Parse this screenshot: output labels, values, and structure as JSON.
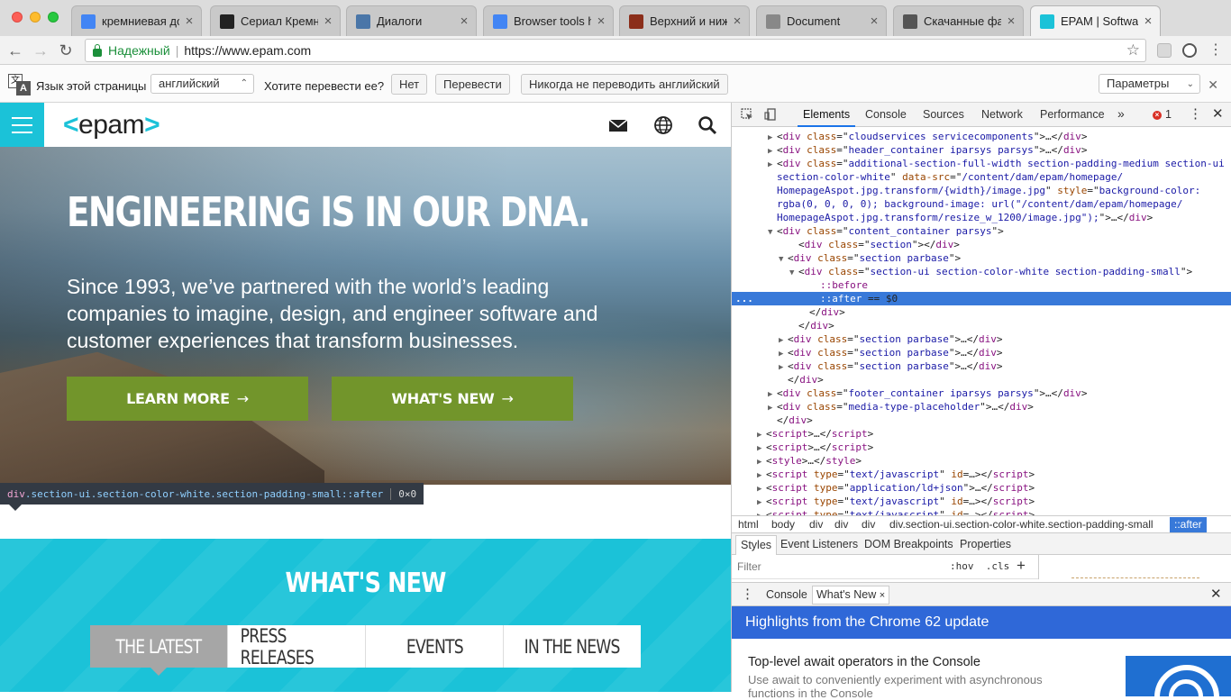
{
  "browser": {
    "tabs": [
      {
        "title": "кремниевая доли",
        "favicon": "google-icon",
        "color": "#4285f4"
      },
      {
        "title": "Сериал Кремние",
        "favicon": "play-icon",
        "color": "#222222"
      },
      {
        "title": "Диалоги",
        "favicon": "vk-icon",
        "color": "#4a76a8"
      },
      {
        "title": "Browser tools hon",
        "favicon": "docs-icon",
        "color": "#4285f4"
      },
      {
        "title": "Верхний и нижні",
        "favicon": "site-icon",
        "color": "#8b2e1a"
      },
      {
        "title": "Document",
        "favicon": "document-icon",
        "color": "#888888"
      },
      {
        "title": "Скачанные файл",
        "favicon": "download-icon",
        "color": "#555555"
      },
      {
        "title": "EPAM | Software",
        "favicon": "epam-icon",
        "color": "#1bc2d8",
        "active": true
      }
    ],
    "address": {
      "secure_label": "Надежный",
      "separator": "|",
      "url": "https://www.epam.com"
    }
  },
  "translate_bar": {
    "language_label": "Язык этой страницы",
    "language_value": "английский",
    "question": "Хотите перевести ее?",
    "no": "Нет",
    "translate": "Перевести",
    "never": "Никогда не переводить английский",
    "options": "Параметры"
  },
  "site": {
    "logo_left": "<",
    "logo_text": "epam",
    "logo_right": ">",
    "hero_title": "ENGINEERING IS IN OUR DNA.",
    "hero_subtitle": "Since 1993, we’ve partnered with the world’s leading companies to imagine, design, and engineer software and customer experiences that transform businesses.",
    "cta_primary": "LEARN MORE",
    "cta_secondary": "WHAT'S NEW",
    "arrow": "→",
    "whats_new_title": "WHAT'S NEW",
    "whats_new_tabs": [
      "THE LATEST",
      "PRESS RELEASES",
      "EVENTS",
      "IN THE NEWS"
    ],
    "inspect_tooltip": {
      "tag": "div",
      "classes": ".section-ui.section-color-white.section-padding-small::after",
      "size": "0×0"
    }
  },
  "devtools": {
    "tabs": [
      "Elements",
      "Console",
      "Sources",
      "Network",
      "Performance",
      "»"
    ],
    "error_count": "1",
    "dom_lines": [
      {
        "indent": 3,
        "tri": "▶",
        "parts": [
          [
            "p",
            "<"
          ],
          [
            "t",
            "div"
          ],
          [
            "p",
            " "
          ],
          [
            "an",
            "class"
          ],
          [
            "p",
            "=\""
          ],
          [
            "av",
            "cloudservices servicecomponents"
          ],
          [
            "p",
            "\">…</"
          ],
          [
            "t",
            "div"
          ],
          [
            "p",
            ">"
          ]
        ]
      },
      {
        "indent": 3,
        "tri": "▶",
        "parts": [
          [
            "p",
            "<"
          ],
          [
            "t",
            "div"
          ],
          [
            "p",
            " "
          ],
          [
            "an",
            "class"
          ],
          [
            "p",
            "=\""
          ],
          [
            "av",
            "header_container iparsys parsys"
          ],
          [
            "p",
            "\">…</"
          ],
          [
            "t",
            "div"
          ],
          [
            "p",
            ">"
          ]
        ]
      },
      {
        "indent": 3,
        "tri": "▶",
        "parts": [
          [
            "p",
            "<"
          ],
          [
            "t",
            "div"
          ],
          [
            "p",
            " "
          ],
          [
            "an",
            "class"
          ],
          [
            "p",
            "=\""
          ],
          [
            "av",
            "additional-section-full-width section-padding-medium section-ui"
          ]
        ]
      },
      {
        "indent": 3,
        "tri": "",
        "parts": [
          [
            "av",
            "section-color-white"
          ],
          [
            "p",
            "\" "
          ],
          [
            "an",
            "data-src"
          ],
          [
            "p",
            "=\""
          ],
          [
            "av",
            "/content/dam/epam/homepage/"
          ]
        ]
      },
      {
        "indent": 3,
        "tri": "",
        "parts": [
          [
            "av",
            "HomepageAspot.jpg.transform/{width}/image.jpg"
          ],
          [
            "p",
            "\" "
          ],
          [
            "an",
            "style"
          ],
          [
            "p",
            "=\""
          ],
          [
            "av",
            "background-color:"
          ]
        ]
      },
      {
        "indent": 3,
        "tri": "",
        "parts": [
          [
            "av",
            "rgba(0, 0, 0, 0); background-image: url(\"/content/dam/epam/homepage/"
          ]
        ]
      },
      {
        "indent": 3,
        "tri": "",
        "parts": [
          [
            "av",
            "HomepageAspot.jpg.transform/resize_w_1200/image.jpg\");"
          ],
          [
            "p",
            "\">…</"
          ],
          [
            "t",
            "div"
          ],
          [
            "p",
            ">"
          ]
        ]
      },
      {
        "indent": 3,
        "tri": "▼",
        "parts": [
          [
            "p",
            "<"
          ],
          [
            "t",
            "div"
          ],
          [
            "p",
            " "
          ],
          [
            "an",
            "class"
          ],
          [
            "p",
            "=\""
          ],
          [
            "av",
            "content_container parsys"
          ],
          [
            "p",
            "\">"
          ]
        ]
      },
      {
        "indent": 5,
        "tri": "",
        "parts": [
          [
            "p",
            "<"
          ],
          [
            "t",
            "div"
          ],
          [
            "p",
            " "
          ],
          [
            "an",
            "class"
          ],
          [
            "p",
            "=\""
          ],
          [
            "av",
            "section"
          ],
          [
            "p",
            "\"></"
          ],
          [
            "t",
            "div"
          ],
          [
            "p",
            ">"
          ]
        ]
      },
      {
        "indent": 4,
        "tri": "▼",
        "parts": [
          [
            "p",
            "<"
          ],
          [
            "t",
            "div"
          ],
          [
            "p",
            " "
          ],
          [
            "an",
            "class"
          ],
          [
            "p",
            "=\""
          ],
          [
            "av",
            "section parbase"
          ],
          [
            "p",
            "\">"
          ]
        ]
      },
      {
        "indent": 5,
        "tri": "▼",
        "parts": [
          [
            "p",
            "<"
          ],
          [
            "t",
            "div"
          ],
          [
            "p",
            " "
          ],
          [
            "an",
            "class"
          ],
          [
            "p",
            "=\""
          ],
          [
            "av",
            "section-ui section-color-white section-padding-small"
          ],
          [
            "p",
            "\">"
          ]
        ]
      },
      {
        "indent": 7,
        "tri": "",
        "parts": [
          [
            "t",
            "::before"
          ]
        ]
      },
      {
        "indent": 7,
        "tri": "",
        "sel": true,
        "parts": [
          [
            "t",
            "::after"
          ],
          [
            "p",
            " == $0"
          ]
        ]
      },
      {
        "indent": 6,
        "tri": "",
        "parts": [
          [
            "p",
            "</"
          ],
          [
            "t",
            "div"
          ],
          [
            "p",
            ">"
          ]
        ]
      },
      {
        "indent": 5,
        "tri": "",
        "parts": [
          [
            "p",
            "</"
          ],
          [
            "t",
            "div"
          ],
          [
            "p",
            ">"
          ]
        ]
      },
      {
        "indent": 4,
        "tri": "▶",
        "parts": [
          [
            "p",
            "<"
          ],
          [
            "t",
            "div"
          ],
          [
            "p",
            " "
          ],
          [
            "an",
            "class"
          ],
          [
            "p",
            "=\""
          ],
          [
            "av",
            "section parbase"
          ],
          [
            "p",
            "\">…</"
          ],
          [
            "t",
            "div"
          ],
          [
            "p",
            ">"
          ]
        ]
      },
      {
        "indent": 4,
        "tri": "▶",
        "parts": [
          [
            "p",
            "<"
          ],
          [
            "t",
            "div"
          ],
          [
            "p",
            " "
          ],
          [
            "an",
            "class"
          ],
          [
            "p",
            "=\""
          ],
          [
            "av",
            "section parbase"
          ],
          [
            "p",
            "\">…</"
          ],
          [
            "t",
            "div"
          ],
          [
            "p",
            ">"
          ]
        ]
      },
      {
        "indent": 4,
        "tri": "▶",
        "parts": [
          [
            "p",
            "<"
          ],
          [
            "t",
            "div"
          ],
          [
            "p",
            " "
          ],
          [
            "an",
            "class"
          ],
          [
            "p",
            "=\""
          ],
          [
            "av",
            "section parbase"
          ],
          [
            "p",
            "\">…</"
          ],
          [
            "t",
            "div"
          ],
          [
            "p",
            ">"
          ]
        ]
      },
      {
        "indent": 4,
        "tri": "",
        "parts": [
          [
            "p",
            "</"
          ],
          [
            "t",
            "div"
          ],
          [
            "p",
            ">"
          ]
        ]
      },
      {
        "indent": 3,
        "tri": "▶",
        "parts": [
          [
            "p",
            "<"
          ],
          [
            "t",
            "div"
          ],
          [
            "p",
            " "
          ],
          [
            "an",
            "class"
          ],
          [
            "p",
            "=\""
          ],
          [
            "av",
            "footer_container iparsys parsys"
          ],
          [
            "p",
            "\">…</"
          ],
          [
            "t",
            "div"
          ],
          [
            "p",
            ">"
          ]
        ]
      },
      {
        "indent": 3,
        "tri": "▶",
        "parts": [
          [
            "p",
            "<"
          ],
          [
            "t",
            "div"
          ],
          [
            "p",
            " "
          ],
          [
            "an",
            "class"
          ],
          [
            "p",
            "=\""
          ],
          [
            "av",
            "media-type-placeholder"
          ],
          [
            "p",
            "\">…</"
          ],
          [
            "t",
            "div"
          ],
          [
            "p",
            ">"
          ]
        ]
      },
      {
        "indent": 3,
        "tri": "",
        "parts": [
          [
            "p",
            "</"
          ],
          [
            "t",
            "div"
          ],
          [
            "p",
            ">"
          ]
        ]
      },
      {
        "indent": 2,
        "tri": "▶",
        "parts": [
          [
            "p",
            "<"
          ],
          [
            "t",
            "script"
          ],
          [
            "p",
            ">…</"
          ],
          [
            "t",
            "script"
          ],
          [
            "p",
            ">"
          ]
        ]
      },
      {
        "indent": 2,
        "tri": "▶",
        "parts": [
          [
            "p",
            "<"
          ],
          [
            "t",
            "script"
          ],
          [
            "p",
            ">…</"
          ],
          [
            "t",
            "script"
          ],
          [
            "p",
            ">"
          ]
        ]
      },
      {
        "indent": 2,
        "tri": "▶",
        "parts": [
          [
            "p",
            "<"
          ],
          [
            "t",
            "style"
          ],
          [
            "p",
            ">…</"
          ],
          [
            "t",
            "style"
          ],
          [
            "p",
            ">"
          ]
        ]
      },
      {
        "indent": 2,
        "tri": "▶",
        "parts": [
          [
            "p",
            "<"
          ],
          [
            "t",
            "script"
          ],
          [
            "p",
            " "
          ],
          [
            "an",
            "type"
          ],
          [
            "p",
            "=\""
          ],
          [
            "av",
            "text/javascript"
          ],
          [
            "p",
            "\" "
          ],
          [
            "an",
            "id"
          ],
          [
            "p",
            "=…></"
          ],
          [
            "t",
            "script"
          ],
          [
            "p",
            ">"
          ]
        ]
      },
      {
        "indent": 2,
        "tri": "▶",
        "parts": [
          [
            "p",
            "<"
          ],
          [
            "t",
            "script"
          ],
          [
            "p",
            " "
          ],
          [
            "an",
            "type"
          ],
          [
            "p",
            "=\""
          ],
          [
            "av",
            "application/ld+json"
          ],
          [
            "p",
            "\">…</"
          ],
          [
            "t",
            "script"
          ],
          [
            "p",
            ">"
          ]
        ]
      },
      {
        "indent": 2,
        "tri": "▶",
        "parts": [
          [
            "p",
            "<"
          ],
          [
            "t",
            "script"
          ],
          [
            "p",
            " "
          ],
          [
            "an",
            "type"
          ],
          [
            "p",
            "=\""
          ],
          [
            "av",
            "text/javascript"
          ],
          [
            "p",
            "\" "
          ],
          [
            "an",
            "id"
          ],
          [
            "p",
            "=…></"
          ],
          [
            "t",
            "script"
          ],
          [
            "p",
            ">"
          ]
        ]
      },
      {
        "indent": 2,
        "tri": "▶",
        "parts": [
          [
            "p",
            "<"
          ],
          [
            "t",
            "script"
          ],
          [
            "p",
            " "
          ],
          [
            "an",
            "type"
          ],
          [
            "p",
            "=\""
          ],
          [
            "av",
            "text/javascript"
          ],
          [
            "p",
            "\" "
          ],
          [
            "an",
            "id"
          ],
          [
            "p",
            "=…></"
          ],
          [
            "t",
            "script"
          ],
          [
            "p",
            ">"
          ]
        ]
      }
    ],
    "breadcrumbs": [
      "html",
      "body",
      "div",
      "div",
      "div",
      "div.section-ui.section-color-white.section-padding-small",
      "::after"
    ],
    "subtabs": [
      "Styles",
      "Event Listeners",
      "DOM Breakpoints",
      "Properties"
    ],
    "filter_placeholder": "Filter",
    "filter_hov": ":hov",
    "filter_cls": ".cls",
    "filter_plus": "+",
    "drawer_tabs": [
      "Console",
      "What's New"
    ],
    "drawer_close": "×",
    "whatsnew": {
      "header": "Highlights from the Chrome 62 update",
      "item_title": "Top-level await operators in the Console",
      "item_desc": "Use await to conveniently experiment with asynchronous functions in the Console"
    }
  }
}
